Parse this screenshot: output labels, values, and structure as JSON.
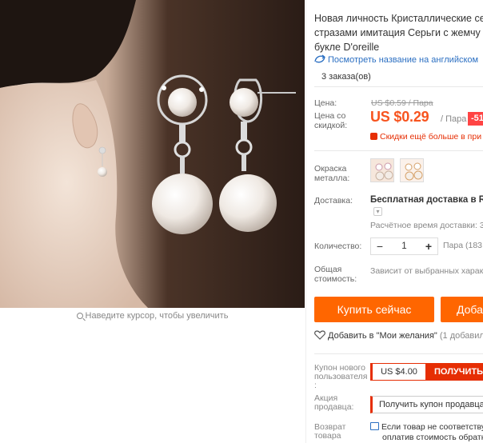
{
  "product": {
    "title_lines": [
      "Новая личность Кристаллические се",
      "стразами имитация Серьги с жемчу",
      "букле D'oreille"
    ],
    "translate_link": "Посмотреть название на английском",
    "orders": "3 заказа(ов)",
    "zoom_hint": "Наведите курсор, чтобы увеличить"
  },
  "price": {
    "label": "Цена:",
    "old_value": "US $0.59 / Пара",
    "discount_label": [
      "Цена со",
      "скидкой:"
    ],
    "value": "US $0.29",
    "unit": "/ Пара",
    "discount_badge": "-51%",
    "more_discounts": "Скидки ещё больше в при"
  },
  "options": {
    "color_label": [
      "Окраска",
      "металла:"
    ],
    "swatch_names": [
      "silver-swatch",
      "gold-swatch"
    ]
  },
  "shipping": {
    "label": "Доставка:",
    "value": "Бесплатная доставка в Russ",
    "time": "Расчётное время доставки: 3"
  },
  "quantity": {
    "label": "Количество:",
    "minus": "−",
    "value": "1",
    "plus": "+",
    "unit": "Пара (183"
  },
  "total": {
    "label": [
      "Общая",
      "стоимость:"
    ],
    "value": "Зависит от выбранных харак"
  },
  "actions": {
    "buy_now": "Купить сейчас",
    "add_to_cart": "Доба",
    "wishlist": "Добавить в \"Мои желания\"",
    "wishlist_count": "(1 добавили)"
  },
  "coupons": {
    "new_user_label": [
      "Купон нового",
      "пользователя",
      ":"
    ],
    "new_user_amount": "US $4.00",
    "get_button": "ПОЛУЧИТЬ",
    "seller_label": [
      "Акция",
      "продавца:"
    ],
    "seller_button": "Получить купон продавца"
  },
  "returns": {
    "label": [
      "Возврат",
      "товара"
    ],
    "text_lines": [
      "Если товар не соответству",
      "оплатив стоимость обратн"
    ]
  },
  "colors": {
    "accent": "#f60",
    "price": "#f7541f",
    "sale": "#e62e04",
    "link": "#2b6fc2"
  }
}
